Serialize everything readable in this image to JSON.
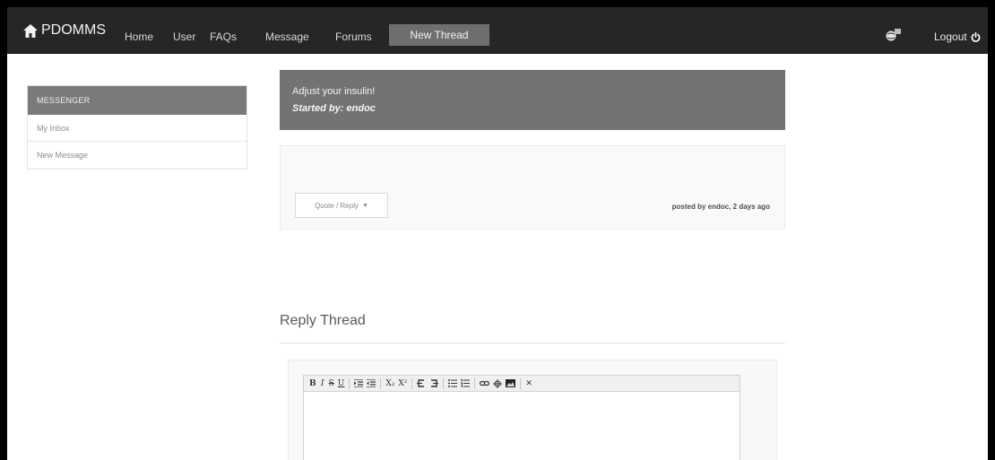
{
  "navbar": {
    "brand": "PDOMMS",
    "links": [
      "Home",
      "User",
      "FAQs",
      "Message",
      "Forums"
    ],
    "active": "New Thread",
    "logout": "Logout"
  },
  "sidebar": {
    "heading": "MESSENGER",
    "items": [
      {
        "label": "My Inbox"
      },
      {
        "label": "New Message"
      }
    ]
  },
  "thread": {
    "title": "Adjust your insulin!",
    "started_by": "Started by: endoc"
  },
  "post": {
    "quote_button": "Quote / Reply",
    "posted_by": "posted by endoc, 2 days ago"
  },
  "reply": {
    "title": "Reply Thread",
    "toolbar": {
      "bold": "B",
      "italic": "I",
      "strike": "S",
      "underline": "U",
      "subscript": "X₂",
      "superscript": "X²",
      "remove": "✕"
    }
  },
  "colors": {
    "navbar_bg": "#262626",
    "active_tab_bg": "#6f6f6f",
    "thread_head_bg": "#737373",
    "sidebar_head_bg": "#7a7a7a"
  }
}
